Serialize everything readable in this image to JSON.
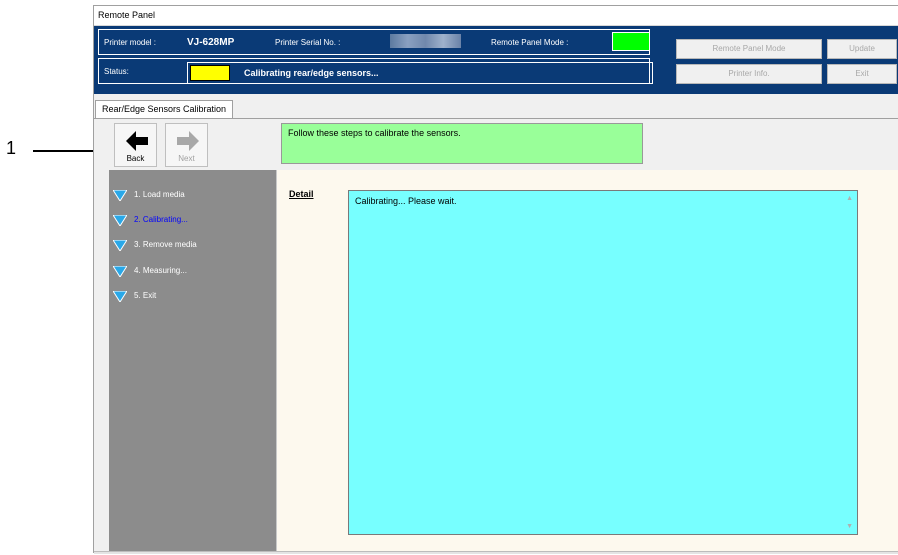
{
  "callout": {
    "number": "1"
  },
  "window": {
    "title": "Remote Panel"
  },
  "header": {
    "printer_model_label": "Printer model :",
    "printer_model_value": "VJ-628MP",
    "serial_label": "Printer Serial No. :",
    "mode_label": "Remote Panel Mode :",
    "status_label": "Status:",
    "status_text": "Calibrating rear/edge sensors...",
    "buttons": {
      "remote_panel_mode": "Remote Panel Mode",
      "update": "Update",
      "printer_info": "Printer Info.",
      "exit": "Exit"
    },
    "colors": {
      "background": "#0a3a76",
      "mode_indicator": "#00ff00",
      "status_indicator": "#ffff00"
    }
  },
  "tab": {
    "label": "Rear/Edge Sensors Calibration"
  },
  "nav": {
    "back_label": "Back",
    "next_label": "Next"
  },
  "message": "Follow these steps to calibrate the sensors.",
  "steps": [
    {
      "label": "1. Load media",
      "active": false
    },
    {
      "label": "2. Calibrating...",
      "active": true
    },
    {
      "label": "3. Remove media",
      "active": false
    },
    {
      "label": "4. Measuring...",
      "active": false
    },
    {
      "label": "5. Exit",
      "active": false
    }
  ],
  "detail": {
    "label": "Detail",
    "text": "Calibrating... Please wait."
  },
  "icons": {
    "back": "arrow-left-icon",
    "next": "arrow-right-icon",
    "step": "triangle-down-icon",
    "scroll_up": "scroll-up-arrow-icon",
    "scroll_down": "scroll-down-arrow-icon"
  }
}
